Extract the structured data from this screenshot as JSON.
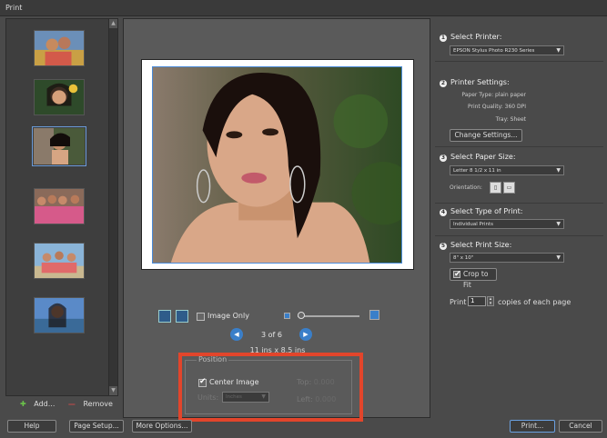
{
  "window": {
    "title": "Print"
  },
  "thumbnails": {
    "add_label": "Add...",
    "remove_label": "Remove"
  },
  "preview": {
    "image_only_label": "Image Only",
    "page_indicator": "3 of 6",
    "size_label": "11 ins x 8.5 ins"
  },
  "position": {
    "legend": "Position",
    "center_image_label": "Center Image",
    "center_image_checked": true,
    "units_label": "Units:",
    "units_value": "Inches",
    "top_label": "Top:",
    "top_value": "0.000",
    "left_label": "Left:",
    "left_value": "0.000"
  },
  "settings": {
    "step1_title": "Select Printer:",
    "printer_value": "EPSON Stylus Photo R230 Series",
    "step2_title": "Printer Settings:",
    "paper_type": "Paper Type: plain paper",
    "print_quality": "Print Quality: 360 DPI",
    "tray": "Tray: Sheet",
    "change_settings_label": "Change Settings...",
    "step3_title": "Select Paper Size:",
    "paper_size_value": "Letter 8 1/2 x 11 in",
    "orientation_label": "Orientation:",
    "step4_title": "Select Type of Print:",
    "print_type_value": "Individual Prints",
    "step5_title": "Select Print Size:",
    "print_size_value": "8\" x 10\"",
    "crop_label": "Crop to Fit",
    "crop_checked": true,
    "print_label": "Print",
    "copies_value": "1",
    "copies_suffix": "copies of each page"
  },
  "footer": {
    "help_label": "Help",
    "page_setup_label": "Page Setup...",
    "more_options_label": "More Options...",
    "print_label": "Print...",
    "cancel_label": "Cancel"
  },
  "colors": {
    "accent": "#3a7fc9",
    "highlight": "#e2452b"
  }
}
